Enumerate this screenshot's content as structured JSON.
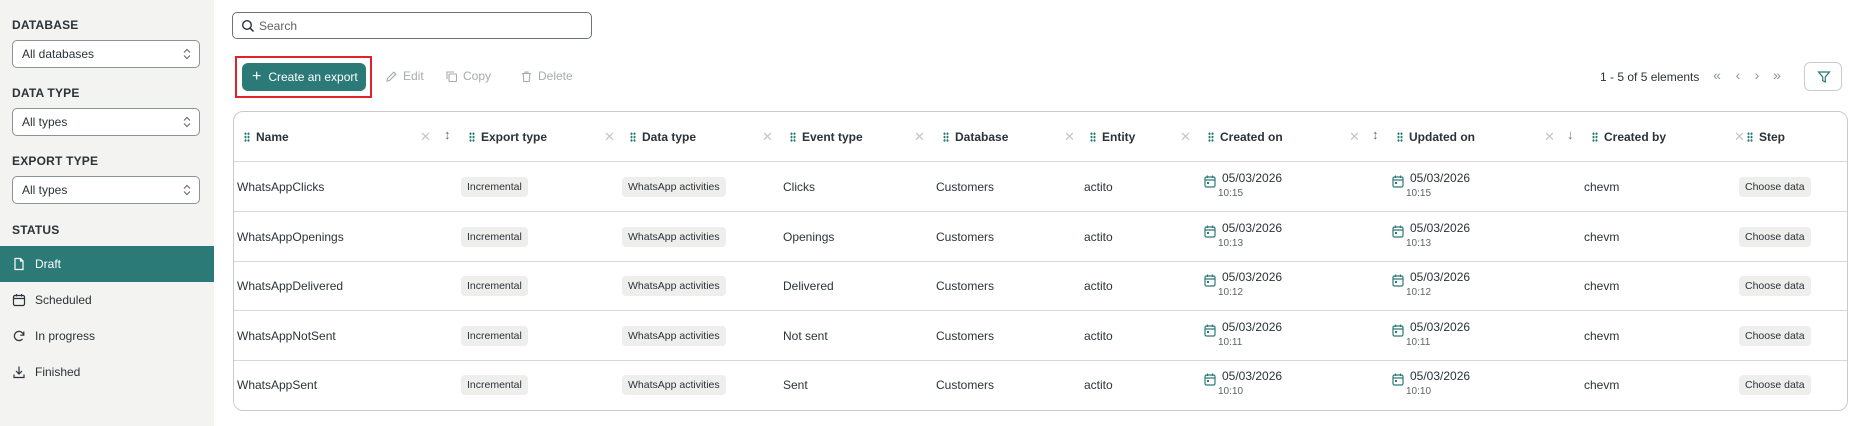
{
  "sidebar": {
    "database_label": "DATABASE",
    "database_value": "All databases",
    "data_type_label": "DATA TYPE",
    "data_type_value": "All types",
    "export_type_label": "EXPORT TYPE",
    "export_type_value": "All types",
    "status_label": "STATUS",
    "status_items": [
      {
        "label": "Draft",
        "icon": "file-icon"
      },
      {
        "label": "Scheduled",
        "icon": "calendar-icon"
      },
      {
        "label": "In progress",
        "icon": "refresh-icon"
      },
      {
        "label": "Finished",
        "icon": "download-icon"
      }
    ]
  },
  "search": {
    "placeholder": "Search"
  },
  "toolbar": {
    "create_label": "Create an export",
    "edit_label": "Edit",
    "copy_label": "Copy",
    "delete_label": "Delete"
  },
  "pagination": {
    "text": "1 - 5 of 5 elements"
  },
  "colors": {
    "accent": "#2b7a78",
    "highlight": "#e0232a",
    "sidebar_bg": "#f3f3f1"
  },
  "table": {
    "columns": [
      "Name",
      "Export type",
      "Data type",
      "Event type",
      "Database",
      "Entity",
      "Created on",
      "Updated on",
      "Created by",
      "Step"
    ],
    "rows": [
      {
        "name": "WhatsAppClicks",
        "export_type": "Incremental",
        "data_type": "WhatsApp activities",
        "event_type": "Clicks",
        "database": "Customers",
        "entity": "actito",
        "created_date": "05/03/2026",
        "created_time": "10:15",
        "updated_date": "05/03/2026",
        "updated_time": "10:15",
        "created_by": "chevm",
        "step": "Choose data"
      },
      {
        "name": "WhatsAppOpenings",
        "export_type": "Incremental",
        "data_type": "WhatsApp activities",
        "event_type": "Openings",
        "database": "Customers",
        "entity": "actito",
        "created_date": "05/03/2026",
        "created_time": "10:13",
        "updated_date": "05/03/2026",
        "updated_time": "10:13",
        "created_by": "chevm",
        "step": "Choose data"
      },
      {
        "name": "WhatsAppDelivered",
        "export_type": "Incremental",
        "data_type": "WhatsApp activities",
        "event_type": "Delivered",
        "database": "Customers",
        "entity": "actito",
        "created_date": "05/03/2026",
        "created_time": "10:12",
        "updated_date": "05/03/2026",
        "updated_time": "10:12",
        "created_by": "chevm",
        "step": "Choose data"
      },
      {
        "name": "WhatsAppNotSent",
        "export_type": "Incremental",
        "data_type": "WhatsApp activities",
        "event_type": "Not sent",
        "database": "Customers",
        "entity": "actito",
        "created_date": "05/03/2026",
        "created_time": "10:11",
        "updated_date": "05/03/2026",
        "updated_time": "10:11",
        "created_by": "chevm",
        "step": "Choose data"
      },
      {
        "name": "WhatsAppSent",
        "export_type": "Incremental",
        "data_type": "WhatsApp activities",
        "event_type": "Sent",
        "database": "Customers",
        "entity": "actito",
        "created_date": "05/03/2026",
        "created_time": "10:10",
        "updated_date": "05/03/2026",
        "updated_time": "10:10",
        "created_by": "chevm",
        "step": "Choose data"
      }
    ]
  }
}
